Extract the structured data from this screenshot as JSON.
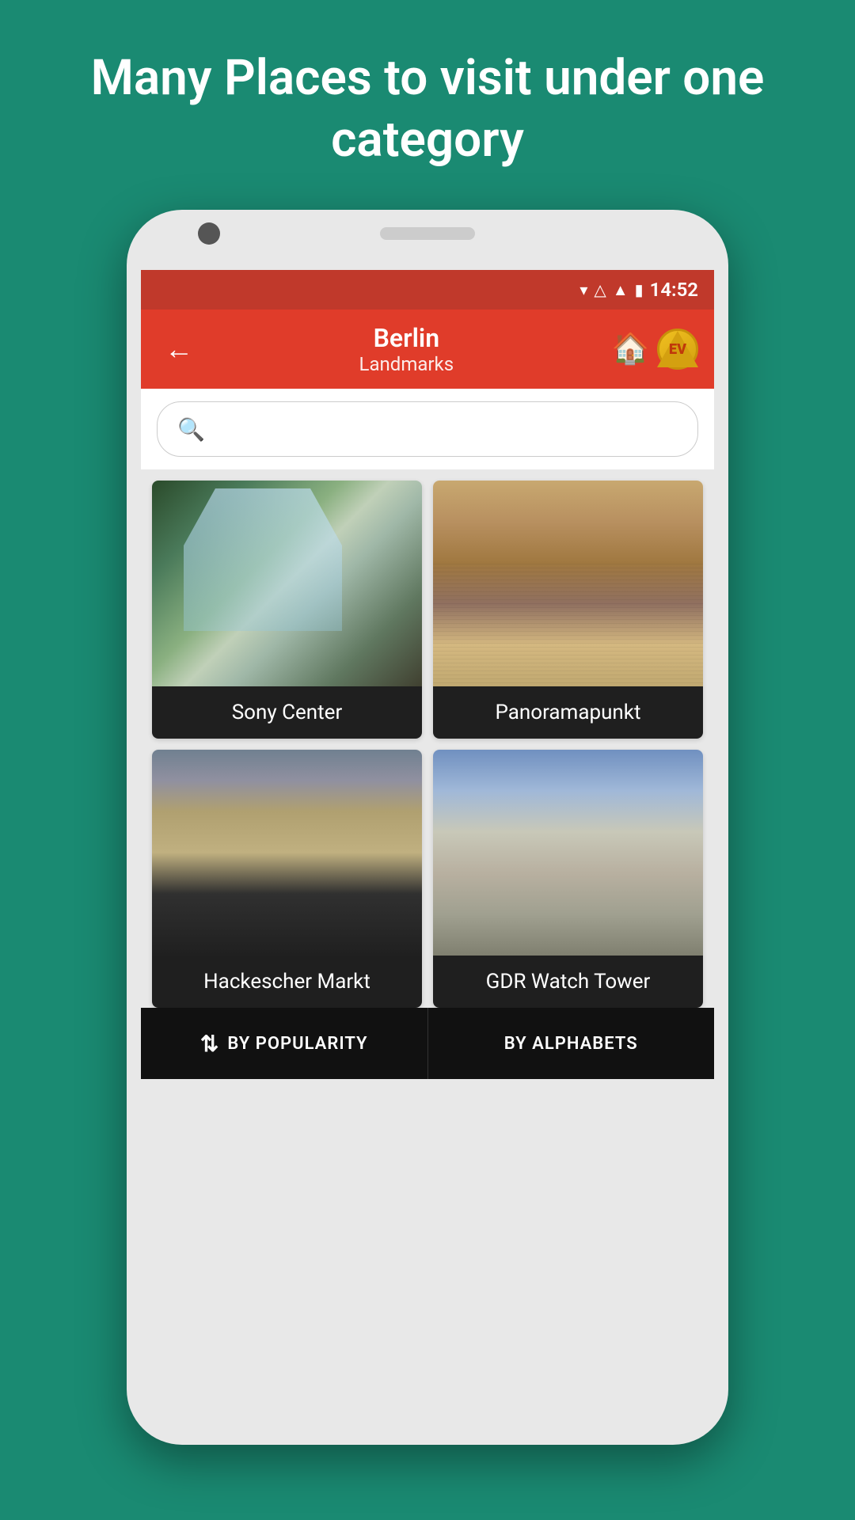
{
  "hero": {
    "text": "Many Places to visit under one category"
  },
  "statusBar": {
    "time": "14:52",
    "icons": [
      "wifi",
      "signal1",
      "signal2",
      "battery"
    ]
  },
  "appBar": {
    "back_label": "←",
    "city": "Berlin",
    "category": "Landmarks",
    "home_icon": "🏠",
    "badge_text": "EV"
  },
  "search": {
    "placeholder": ""
  },
  "places": [
    {
      "id": "sony-center",
      "name": "Sony Center",
      "image_type": "sony"
    },
    {
      "id": "panoramapunkt",
      "name": "Panoramapunkt",
      "image_type": "panorama"
    },
    {
      "id": "hackescher-markt",
      "name": "Hackescher Markt",
      "image_type": "hackescher"
    },
    {
      "id": "gdr-watch-tower",
      "name": "GDR Watch Tower",
      "image_type": "gdr"
    }
  ],
  "sortBar": {
    "by_popularity": "BY POPULARITY",
    "by_alphabets": "BY ALPHABETS",
    "sort_icon": "⇅"
  }
}
